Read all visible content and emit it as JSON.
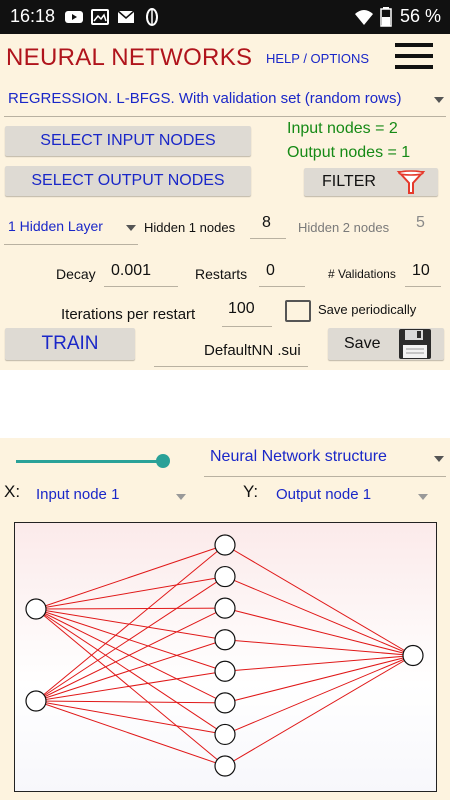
{
  "status_bar": {
    "time": "16:18",
    "battery": "56 %",
    "icons": [
      "youtube-icon",
      "image-icon",
      "mail-icon",
      "leaf-icon",
      "wifi-icon",
      "battery-icon"
    ]
  },
  "header": {
    "title": "NEURAL NETWORKS",
    "help_options": "HELP / OPTIONS",
    "menu_icon": "hamburger-menu-icon"
  },
  "panel": {
    "method_select": "REGRESSION. L-BFGS. With validation set (random rows)",
    "select_input_button": "SELECT INPUT NODES",
    "select_output_button": "SELECT OUTPUT NODES",
    "input_nodes_text": "Input nodes = 2",
    "output_nodes_text": "Output nodes = 1",
    "filter_button": "FILTER",
    "hidden_layers_select": "1 Hidden Layer",
    "hidden1_label": "Hidden 1 nodes",
    "hidden1_value": "8",
    "hidden2_label": "Hidden 2 nodes",
    "hidden2_value": "5",
    "decay_label": "Decay",
    "decay_value": "0.001",
    "restarts_label": "Restarts",
    "restarts_value": "0",
    "validations_label": "# Validations",
    "validations_value": "10",
    "iterations_label": "Iterations per restart",
    "iterations_value": "100",
    "save_periodically_label": "Save periodically",
    "save_periodically_checked": false,
    "train_button": "TRAIN",
    "filename": "DefaultNN .sui",
    "save_button": "Save"
  },
  "plot_controls": {
    "plot_type_select": "Neural Network structure",
    "x_label": "X:",
    "x_select": "Input node 1",
    "y_label": "Y:",
    "y_select": "Output node 1",
    "slider_fraction": 1.0
  },
  "network": {
    "input_nodes": 2,
    "hidden_nodes": 8,
    "output_nodes": 1,
    "edge_color": "#e01818"
  },
  "colors": {
    "accent_red": "#b0141c",
    "accent_blue": "#1a27c8",
    "accent_green": "#168a16",
    "slider_teal": "#2aa198"
  }
}
